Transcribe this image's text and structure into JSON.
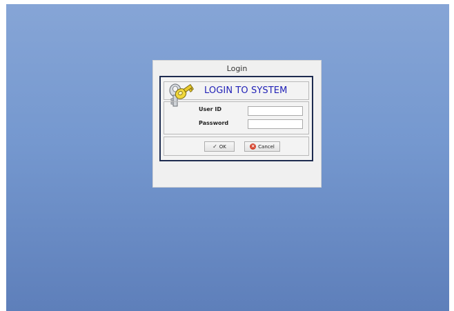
{
  "window": {
    "title": "Login"
  },
  "header": {
    "title": "LOGIN TO SYSTEM",
    "icon": "keys-icon"
  },
  "form": {
    "user_id_label": "User ID",
    "user_id_value": "",
    "password_label": "Password",
    "password_value": ""
  },
  "buttons": {
    "ok_label": "OK",
    "ok_icon": "check-icon",
    "cancel_label": "Cancel",
    "cancel_icon": "cancel-icon"
  },
  "colors": {
    "title_blue": "#1f1fb6",
    "panel_border": "#1d2b4f",
    "desktop_top": "#86a5d6",
    "desktop_bottom": "#5e7fba"
  }
}
